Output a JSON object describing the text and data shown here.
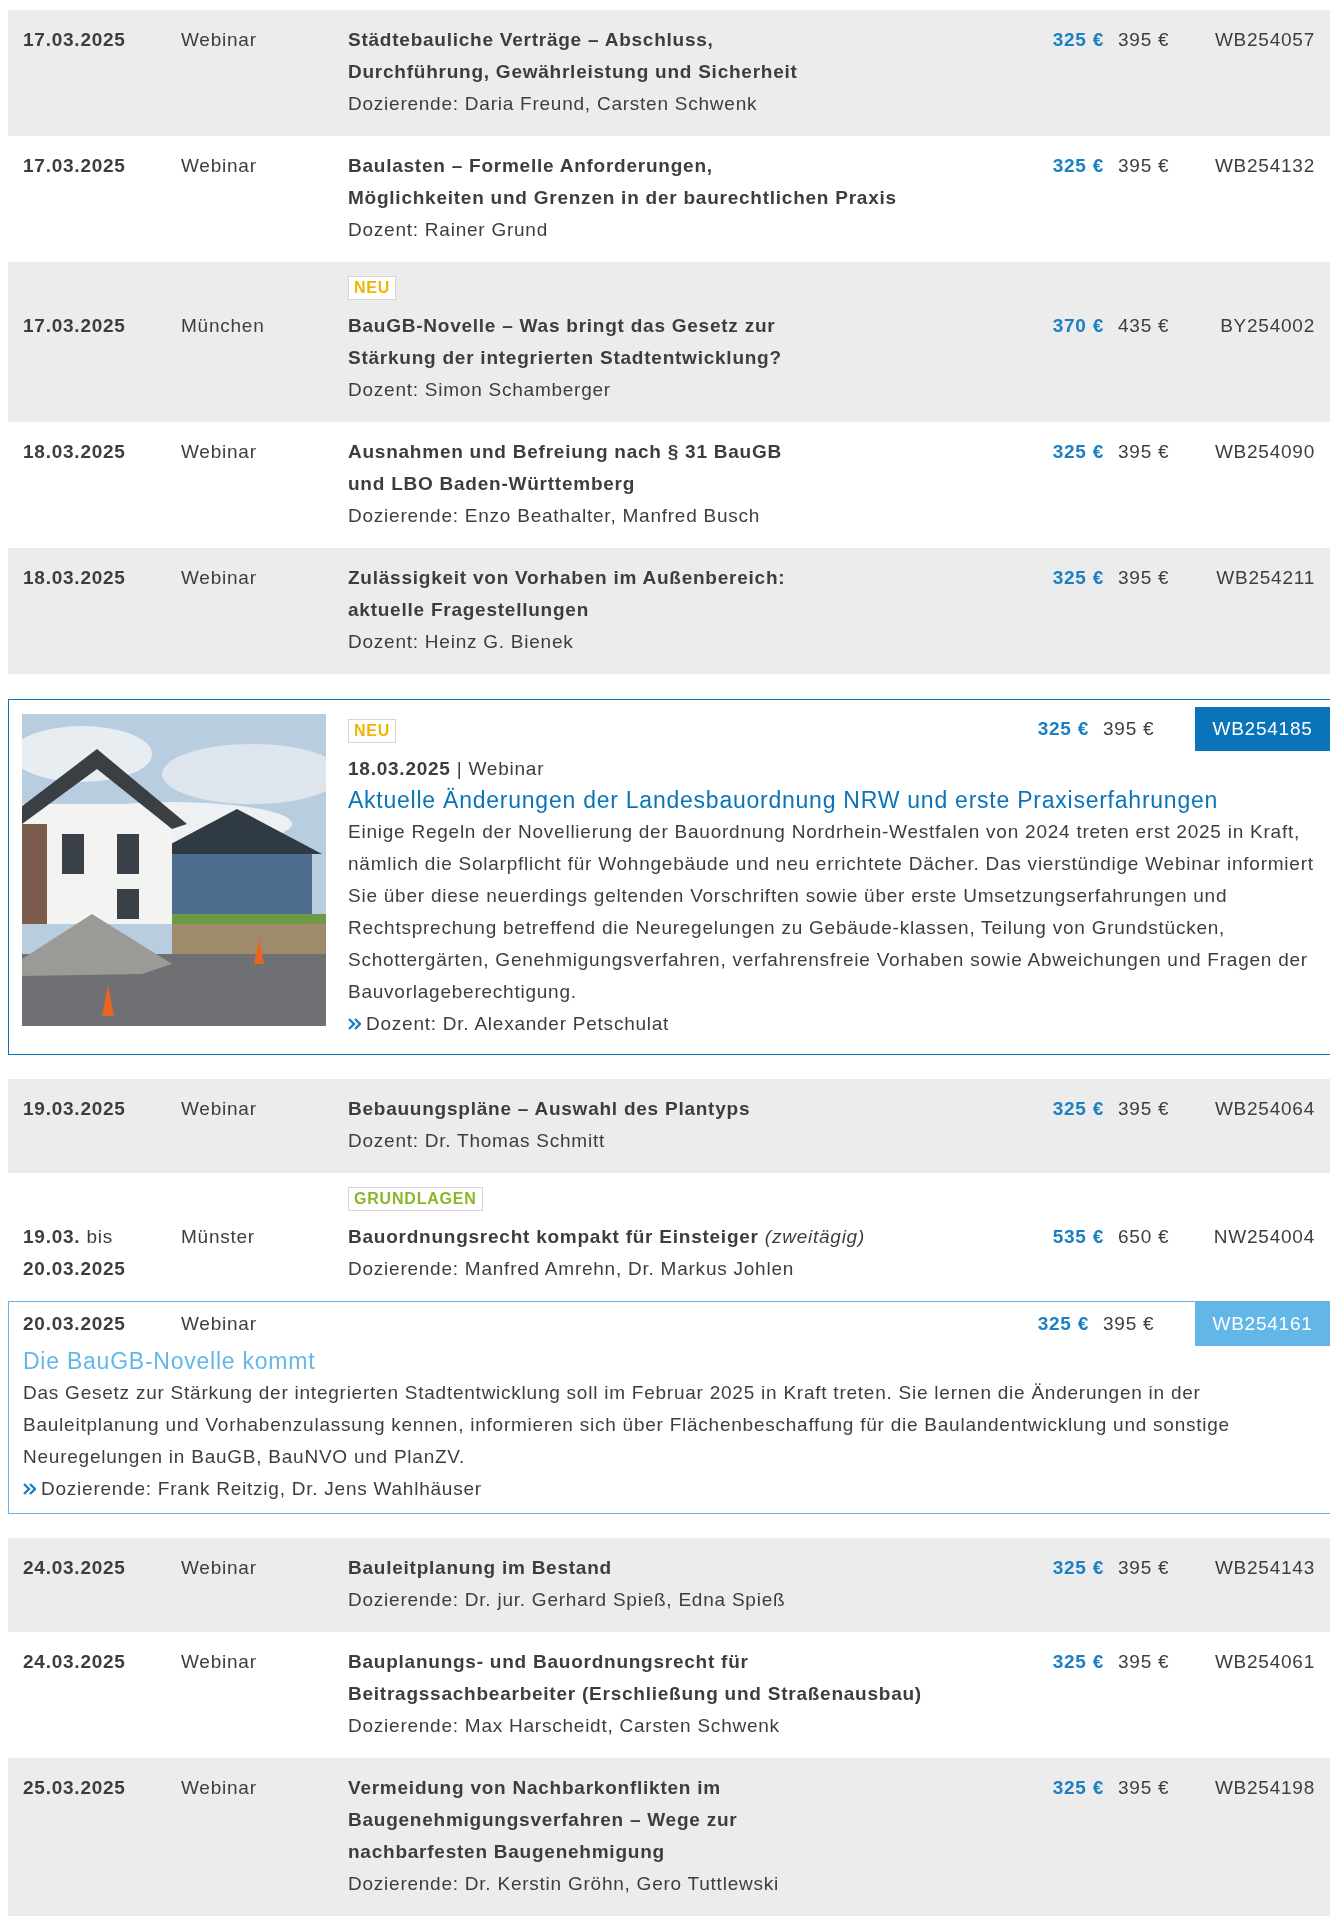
{
  "items": [
    {
      "kind": "row",
      "shaded": true,
      "date": "17.03.2025",
      "place": "Webinar",
      "title_lines": [
        "Städtebauliche Verträge – Abschluss,",
        "Durchführung, Gewährleistung und Sicherheit"
      ],
      "lecturers": "Dozierende: Daria Freund, Carsten Schwenk",
      "price": "325 €",
      "old_price": "395 €",
      "code": "WB254057"
    },
    {
      "kind": "row",
      "shaded": false,
      "date": "17.03.2025",
      "place": "Webinar",
      "title_lines": [
        "Baulasten – Formelle Anforderungen,",
        "Möglichkeiten und Grenzen in der baurechtlichen Praxis"
      ],
      "lecturers": "Dozent: Rainer Grund",
      "price": "325 €",
      "old_price": "395 €",
      "code": "WB254132"
    },
    {
      "kind": "row",
      "shaded": true,
      "badge": {
        "label": "NEU",
        "color": "#f0b400"
      },
      "date": "17.03.2025",
      "place": "München",
      "title_lines": [
        "BauGB-Novelle – Was bringt das Gesetz zur",
        "Stärkung der integrierten Stadtentwicklung?"
      ],
      "lecturers": "Dozent: Simon Schamberger",
      "price": "370 €",
      "old_price": "435 €",
      "code": "BY254002"
    },
    {
      "kind": "row",
      "shaded": false,
      "date": "18.03.2025",
      "place": "Webinar",
      "title_lines": [
        "Ausnahmen und Befreiung nach § 31 BauGB",
        "und LBO Baden-Württemberg"
      ],
      "lecturers": "Dozierende: Enzo Beathalter, Manfred Busch",
      "price": "325 €",
      "old_price": "395 €",
      "code": "WB254090"
    },
    {
      "kind": "row",
      "shaded": true,
      "date": "18.03.2025",
      "place": "Webinar",
      "title_lines": [
        "Zulässigkeit von Vorhaben im Außenbereich:",
        "aktuelle Fragestellungen"
      ],
      "lecturers": "Dozent: Heinz G. Bienek",
      "price": "325 €",
      "old_price": "395 €",
      "code": "WB254211"
    },
    {
      "kind": "featured",
      "color": "#0a74ba",
      "badge": {
        "label": "NEU",
        "color": "#f0b400"
      },
      "date": "18.03.2025",
      "separator": "|",
      "place": "Webinar",
      "title": "Aktuelle Änderungen der Landesbauordnung NRW und erste Praxiserfahrungen",
      "description": "Einige Regeln der Novellierung der Bauordnung Nordrhein-Westfalen von 2024 treten erst 2025 in Kraft, nämlich die Solarpflicht für Wohngebäude und neu errichtete Dächer. Das vierstündige Webinar informiert Sie über diese neuerdings geltenden Vorschriften sowie über erste Umsetzungserfahrungen und Rechtsprechung betreffend die Neuregelungen zu Gebäude-klassen, Teilung von Grundstücken, Schottergärten, Genehmigungsverfahren, verfahrensfreie Vorhaben sowie Abweichungen und Fragen der Bauvorlageberechtigung.",
      "lecturers": "Dozent: Dr. Alexander Petschulat",
      "price": "325 €",
      "old_price": "395 €",
      "code": "WB254185"
    },
    {
      "kind": "row",
      "shaded": true,
      "date": "19.03.2025",
      "place": "Webinar",
      "title_lines": [
        "Bebauungspläne – Auswahl des Plantyps"
      ],
      "lecturers": "Dozent: Dr. Thomas Schmitt",
      "price": "325 €",
      "old_price": "395 €",
      "code": "WB254064"
    },
    {
      "kind": "row",
      "shaded": false,
      "badge": {
        "label": "GRUNDLAGEN",
        "color": "#8cb526"
      },
      "date": "19.03.",
      "date_note": "bis",
      "date_end": "20.03.2025",
      "place": "Münster",
      "title_lines": [
        "Bauordnungsrecht kompakt für Einsteiger"
      ],
      "title_note": "(zweitägig)",
      "lecturers": "Dozierende: Manfred Amrehn, Dr. Markus Johlen",
      "price": "535 €",
      "old_price": "650 €",
      "code": "NW254004"
    },
    {
      "kind": "featured",
      "color": "#62b7e8",
      "date": "20.03.2025",
      "place": "Webinar",
      "title": "Die BauGB-Novelle kommt",
      "description": "Das Gesetz zur Stärkung der integrierten Stadtentwicklung soll im Februar 2025 in Kraft treten. Sie lernen die Änderungen in der Bauleitplanung und Vorhabenzulassung kennen, informieren sich über Flächenbeschaffung für die Baulandentwicklung und sonstige Neuregelungen in BauGB, BauNVO und PlanZV.",
      "lecturers": "Dozierende: Frank Reitzig, Dr. Jens Wahlhäuser",
      "price": "325 €",
      "old_price": "395 €",
      "code": "WB254161"
    },
    {
      "kind": "row",
      "shaded": true,
      "date": "24.03.2025",
      "place": "Webinar",
      "title_lines": [
        "Bauleitplanung im Bestand"
      ],
      "lecturers": "Dozierende: Dr. jur. Gerhard Spieß, Edna Spieß",
      "price": "325 €",
      "old_price": "395 €",
      "code": "WB254143"
    },
    {
      "kind": "row",
      "shaded": false,
      "date": "24.03.2025",
      "place": "Webinar",
      "title_lines": [
        "Bauplanungs- und Bauordnungsrecht für",
        "Beitragssachbearbeiter (Erschließung und Straßenausbau)"
      ],
      "lecturers": "Dozierende: Max Harscheidt, Carsten Schwenk",
      "price": "325 €",
      "old_price": "395 €",
      "code": "WB254061"
    },
    {
      "kind": "row",
      "shaded": true,
      "date": "25.03.2025",
      "place": "Webinar",
      "title_lines": [
        "Vermeidung von Nachbarkonflikten im",
        "Baugenehmigungsverfahren – Wege zur",
        "nachbarfesten Baugenehmigung"
      ],
      "lecturers": "Dozierende: Dr. Kerstin Gröhn, Gero Tuttlewski",
      "price": "325 €",
      "old_price": "395 €",
      "code": "WB254198"
    }
  ]
}
